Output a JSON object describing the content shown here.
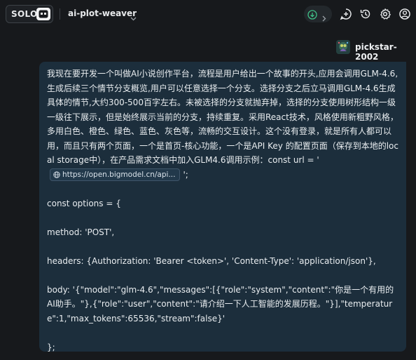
{
  "header": {
    "mode_label": "SOLO",
    "project_name": "ai-plot-weaver"
  },
  "user": {
    "name": "pickstar-2002"
  },
  "message": {
    "para1_before_link": "我现在要开发一个叫做AI小说创作平台，流程是用户给出一个故事的开头,应用会调用GLM-4.6,生成后续三个情节分支概览,用户可以任意选择一个分支。选择分支之后立马调用GLM-4.6生成具体的情节,大约300-500百字左右。未被选择的分支就抛弃掉，选择的分支使用树形结构一级一级往下展示，但是始终展示当前的分支，持续重复。采用React技术，风格使用新粗野风格，多用白色、橙色、绿色、蓝色、灰色等，流畅的交互设计。这个没有登录，就是所有人都可以用，而且只有两个页面，一个是首页-核心功能，一个是API Key 的配置页面（保存到本地的local storage中），在产品需求文档中加入GLM4.6调用示例：const url = '",
    "link_text": "https://open.bigmodel.cn/api...",
    "para1_after_link": "';",
    "line_options": "const options = {",
    "line_method": "method: 'POST',",
    "line_headers": "headers: {Authorization: 'Bearer <token>', 'Content-Type': 'application/json'},",
    "line_body": "body: '{\"model\":\"glm-4.6\",\"messages\":[{\"role\":\"system\",\"content\":\"你是一个有用的AI助手。\"},{\"role\":\"user\",\"content\":\"请介绍一下人工智能的发展历程。\"}],\"temperature\":1,\"max_tokens\":65536,\"stream\":false}'",
    "line_close": "};"
  }
}
